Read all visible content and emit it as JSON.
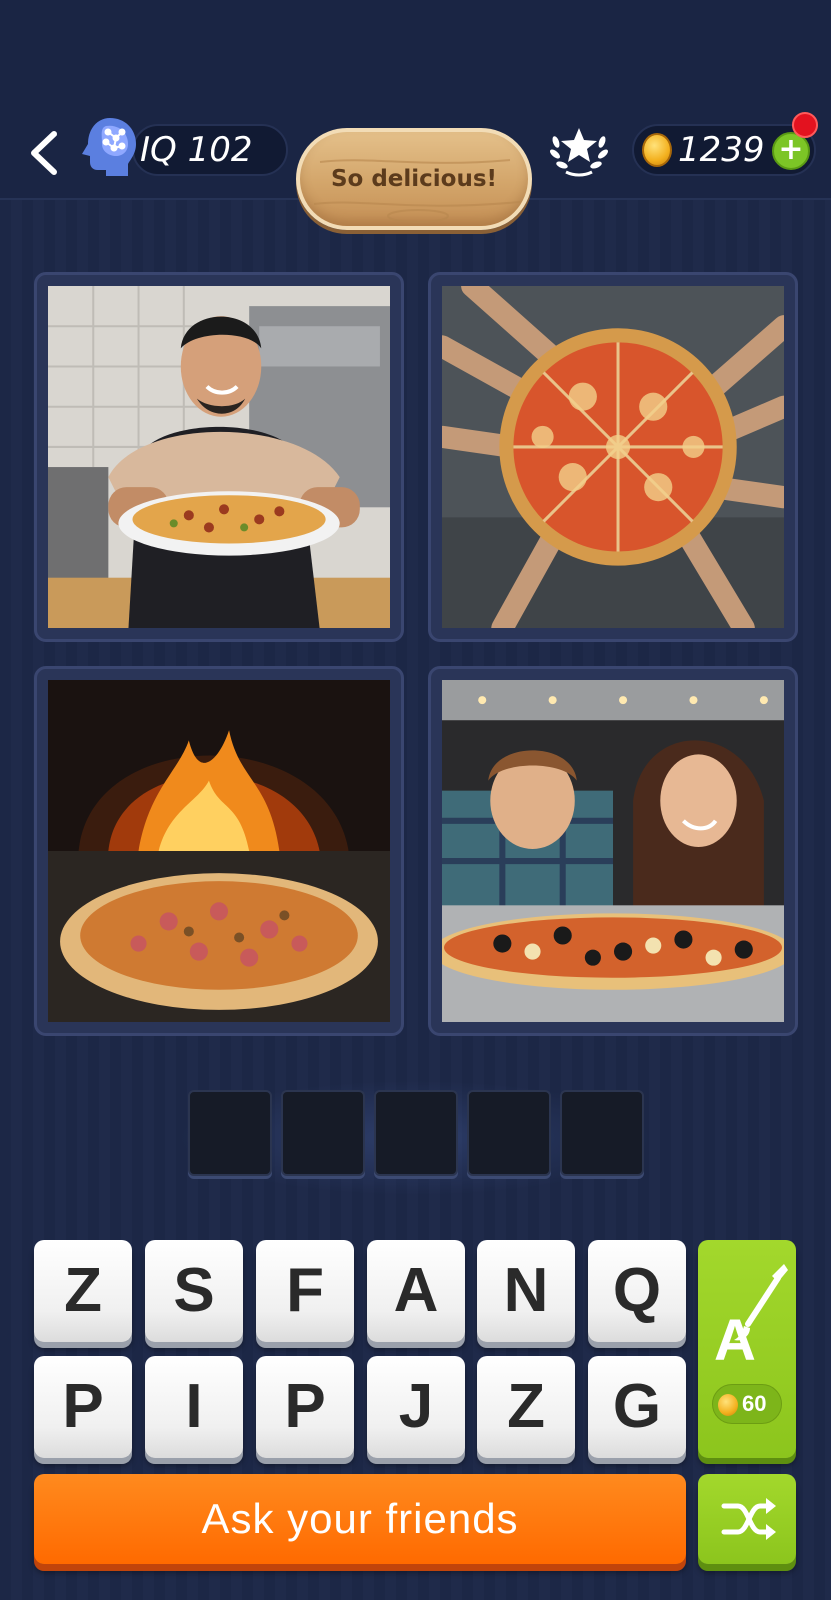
{
  "header": {
    "iq_label": "IQ 102",
    "badge_text": "So delicious!",
    "coins": "1239",
    "icons": [
      "back-arrow-icon",
      "brain-head-icon",
      "star-wreath-icon",
      "coin-icon",
      "plus-icon"
    ]
  },
  "puzzle": {
    "images": [
      {
        "name": "chef-holding-pizza"
      },
      {
        "name": "hands-grabbing-pizza-slices"
      },
      {
        "name": "pizza-in-wood-fired-oven"
      },
      {
        "name": "couple-watching-pizza-oven"
      }
    ],
    "answer_slots": 5
  },
  "keyboard": {
    "row1": [
      "Z",
      "S",
      "F",
      "A",
      "N",
      "Q"
    ],
    "row2": [
      "P",
      "I",
      "P",
      "J",
      "Z",
      "G"
    ],
    "hint_cost": "60"
  },
  "actions": {
    "ask_friends": "Ask your friends"
  },
  "colors": {
    "background": "#1c2746",
    "orange_button": "#ff6a00",
    "green_button": "#8cc51d",
    "badge_wood": "#d3a56a"
  }
}
